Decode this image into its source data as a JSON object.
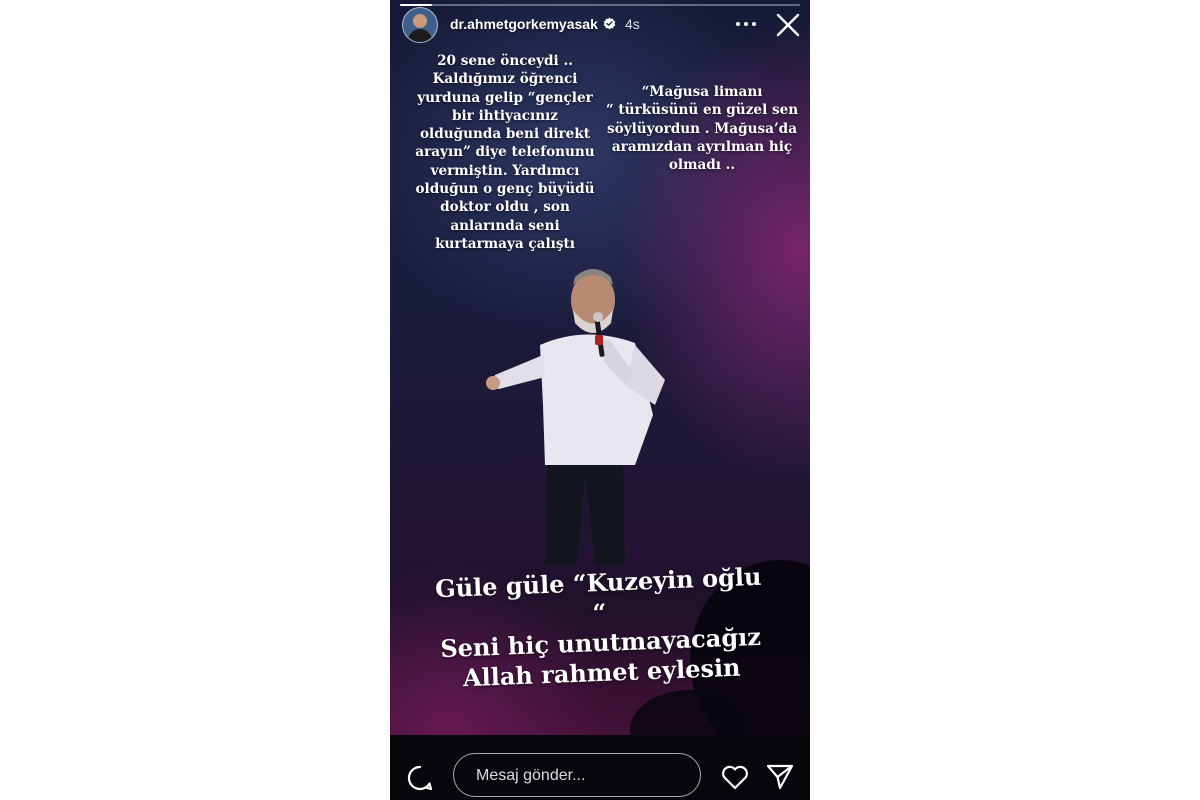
{
  "story": {
    "username": "dr.ahmetgorkemyasak",
    "verified": true,
    "time": "4s",
    "progress_fraction": 0.08
  },
  "captions": {
    "left": "20 sene önceydi ..\nKaldığımız öğrenci\nyurduna gelip “gençler\nbir ihtiyacınız\nolduğunda beni direkt\narayın” diye telefonunu\nvermiştin. Yardımcı\nolduğun o genç büyüdü\ndoktor oldu , son\nanlarında seni\nkurtarmaya çalıştı",
    "right": "“Mağusa limanı\n“ türküsünü en güzel sen\nsöylüyordun . Mağusa’da\naramızdan ayrılman hiç\nolmadı ..",
    "main": "Güle güle “Kuzeyin oğlu “\nSeni hiç unutmayacağız\nAllah rahmet eylesin"
  },
  "footer": {
    "message_placeholder": "Mesaj gönder..."
  },
  "icons": {
    "more": "more-horizontal-icon",
    "close": "close-icon",
    "comment": "comment-icon",
    "like": "heart-icon",
    "share": "send-icon"
  },
  "colors": {
    "text": "#ffffff",
    "background": "#0b0d16",
    "stage_magenta": "#96287a"
  }
}
